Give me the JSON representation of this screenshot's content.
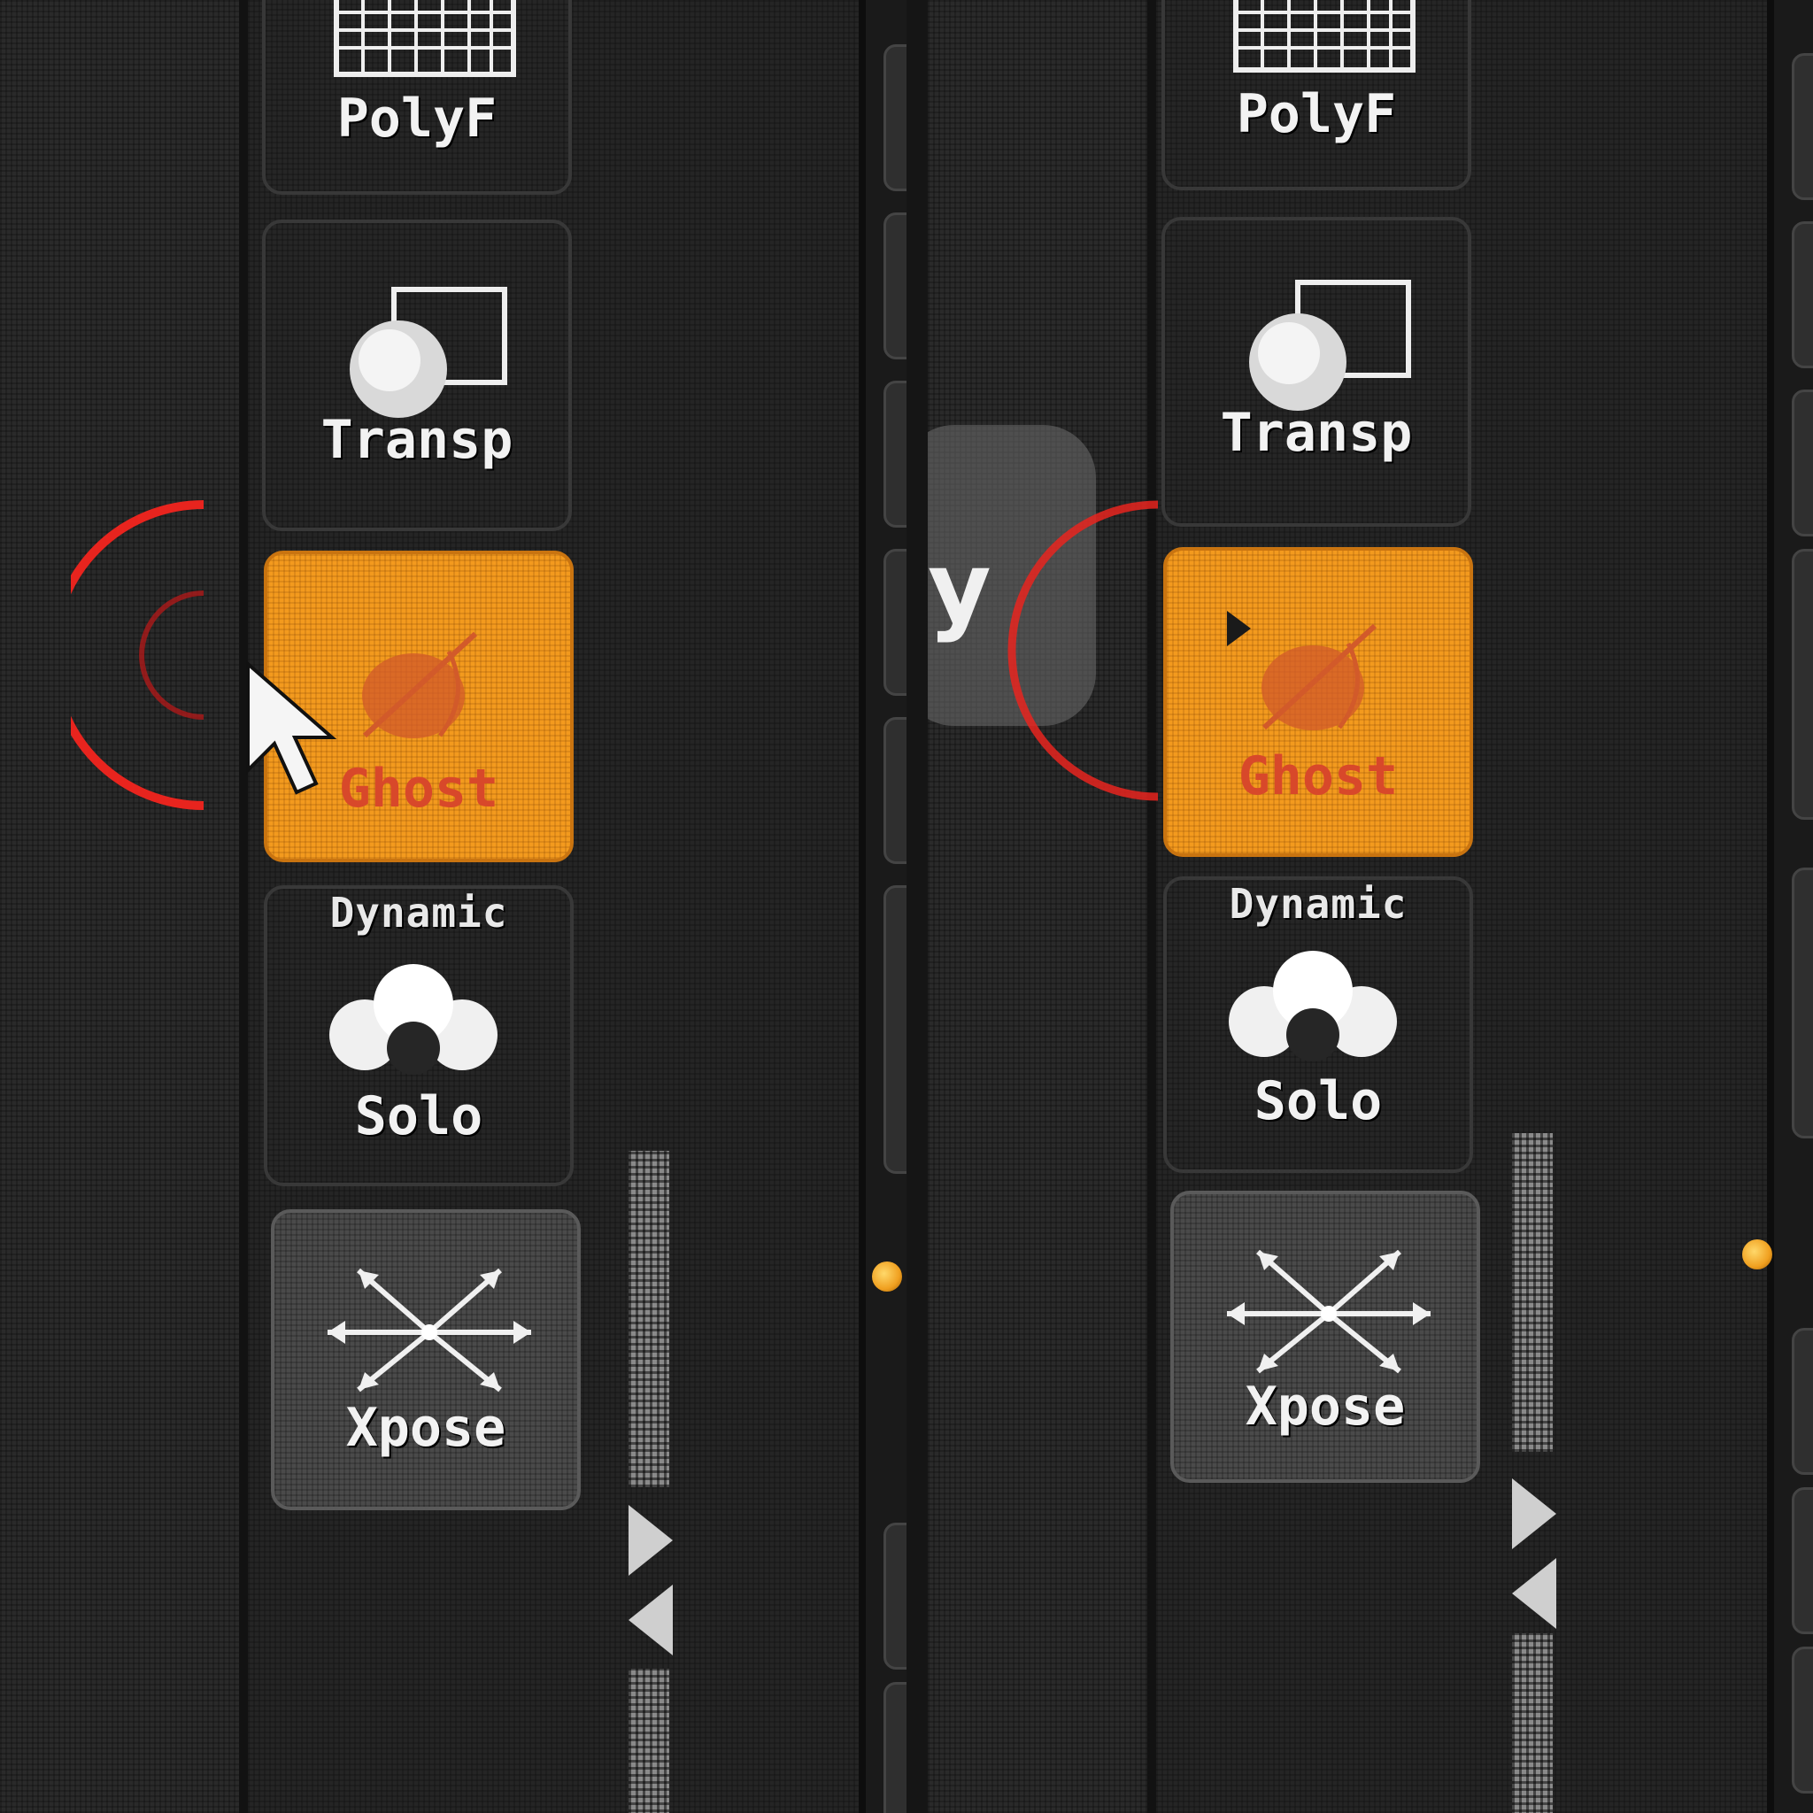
{
  "panels": [
    {
      "tools": {
        "polyf_label": "PolyF",
        "transp_label": "Transp",
        "ghost_label": "Ghost",
        "solo_top_label": "Dynamic",
        "solo_label": "Solo",
        "xpose_label": "Xpose"
      }
    },
    {
      "tools": {
        "polyf_label": "PolyF",
        "transp_label": "Transp",
        "ghost_label": "Ghost",
        "solo_top_label": "Dynamic",
        "solo_label": "Solo",
        "xpose_label": "Xpose"
      },
      "partial_text": "y"
    }
  ],
  "colors": {
    "active_button": "#f39a1e",
    "active_label": "#d8482a",
    "click_ring": "#e8241e",
    "indicator_dot": "#f0a020"
  },
  "states": {
    "ghost_active": true
  }
}
